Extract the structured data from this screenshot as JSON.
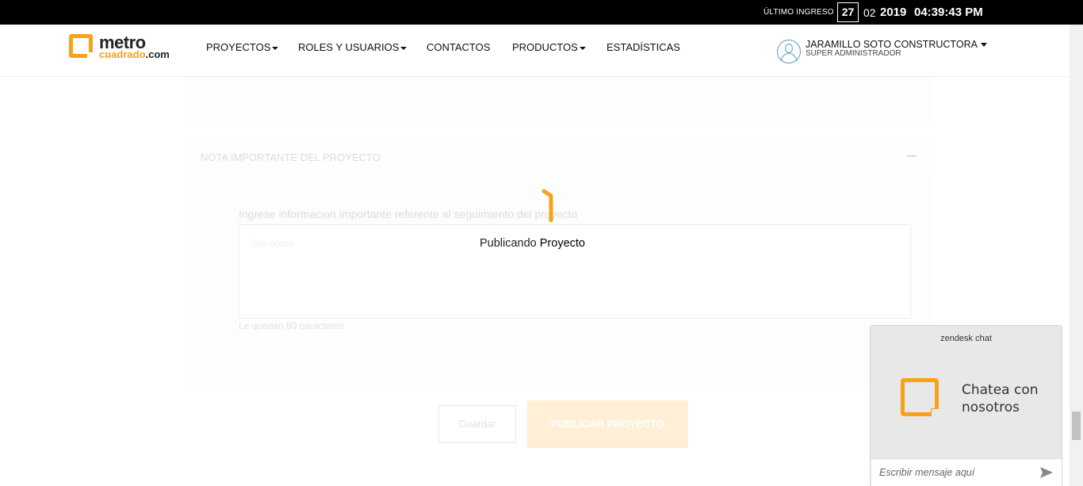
{
  "topbar": {
    "last_login_label": "ÚLTIMO INGRESO",
    "day": "27",
    "month": "02",
    "year": "2019",
    "time": "04:39:43 PM"
  },
  "logo": {
    "line1": "metro",
    "line2": "cuadrado",
    "suffix": ".com"
  },
  "nav": {
    "items": [
      {
        "label": "PROYECTOS",
        "dropdown": true
      },
      {
        "label": "ROLES Y USUARIOS",
        "dropdown": true
      },
      {
        "label": "CONTACTOS",
        "dropdown": false
      },
      {
        "label": "PRODUCTOS",
        "dropdown": true
      },
      {
        "label": "ESTADÍSTICAS",
        "dropdown": false
      }
    ]
  },
  "user": {
    "name": "JARAMILLO SOTO CONSTRUCTORA",
    "role": "SUPER ADMINISTRADOR"
  },
  "form": {
    "section_title": "NOTA IMPORTANTE DEL PROYECTO",
    "help_text": "Ingrese informacion importante referente al seguimiento del proyecto",
    "notes_placeholder": "Sus notas",
    "char_count": "Le quedan 80 caracteres",
    "save_label": "Guardar",
    "publish_label": "PUBLICAR PROYECTO"
  },
  "loading": {
    "text1": "Publicando",
    "text2": "Proyecto"
  },
  "chat": {
    "brand": "zendesk chat",
    "title": "Chatea con nosotros",
    "input_placeholder": "Escribir mensaje aquí"
  },
  "colors": {
    "accent": "#f7a21b",
    "topbar": "#000000",
    "avatar_outline": "#5a9ac7"
  }
}
